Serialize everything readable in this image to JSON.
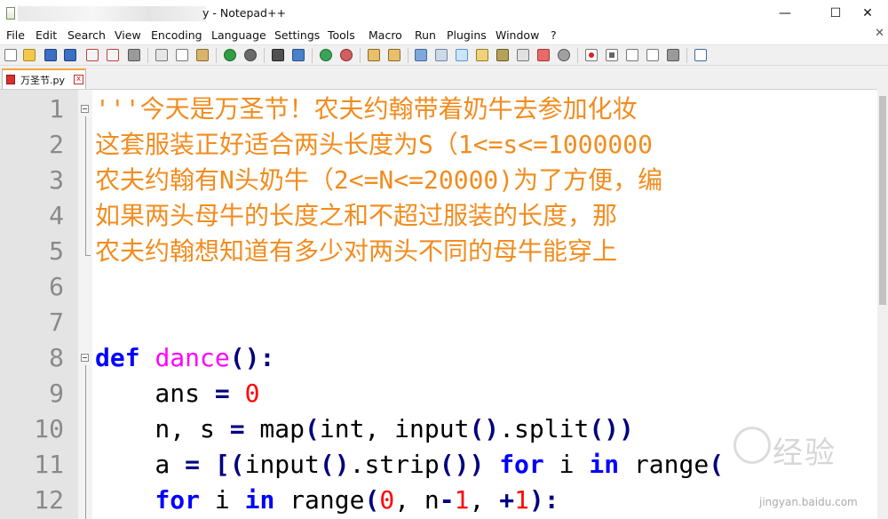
{
  "window": {
    "title": "y - Notepad++",
    "minimize_glyph": "—",
    "maximize_glyph": "☐",
    "close_glyph": "✕"
  },
  "menu": {
    "items": [
      "File",
      "Edit",
      "Search",
      "View",
      "Encoding",
      "Language",
      "Settings",
      "Tools",
      "Macro",
      "Run",
      "Plugins",
      "Window",
      "?"
    ],
    "close_glyph": "✕"
  },
  "toolbar": {
    "icons": [
      "new-file-icon",
      "open-file-icon",
      "save-icon",
      "save-all-icon",
      "close-icon",
      "close-all-icon",
      "print-icon",
      "cut-icon",
      "copy-icon",
      "paste-icon",
      "undo-icon",
      "redo-icon",
      "find-icon",
      "replace-icon",
      "zoom-in-icon",
      "zoom-out-icon",
      "sync-vertical-icon",
      "sync-horizontal-icon",
      "word-wrap-icon",
      "show-all-chars-icon",
      "indent-guide-icon",
      "user-language-icon",
      "doc-map-icon",
      "function-list-icon",
      "folder-workspace-icon",
      "monitor-icon",
      "record-macro-icon",
      "stop-macro-icon",
      "play-macro-icon",
      "run-macro-multiple-icon",
      "save-macro-icon",
      "launch-icon"
    ]
  },
  "tab": {
    "label": "万圣节.py",
    "close_glyph": "x"
  },
  "editor": {
    "lines": [
      {
        "num": "1",
        "segments": [
          {
            "t": "'''今天是万圣节！农夫约翰带着奶牛去参加化妆",
            "c": "doc"
          }
        ]
      },
      {
        "num": "2",
        "segments": [
          {
            "t": "这套服装正好适合两头长度为S（1<=s<=1000000",
            "c": "doc"
          }
        ]
      },
      {
        "num": "3",
        "segments": [
          {
            "t": "农夫约翰有N头奶牛（2<=N<=20000)为了方便，编",
            "c": "doc"
          }
        ]
      },
      {
        "num": "4",
        "segments": [
          {
            "t": "如果两头母牛的长度之和不超过服装的长度，那",
            "c": "doc"
          }
        ]
      },
      {
        "num": "5",
        "segments": [
          {
            "t": "农夫约翰想知道有多少对两头不同的母牛能穿上",
            "c": "doc"
          }
        ]
      },
      {
        "num": "6",
        "segments": []
      },
      {
        "num": "7",
        "segments": []
      },
      {
        "num": "8",
        "segments": [
          {
            "t": "def",
            "c": "kw"
          },
          {
            "t": " ",
            "c": ""
          },
          {
            "t": "dance",
            "c": "fn"
          },
          {
            "t": "():",
            "c": "op"
          }
        ]
      },
      {
        "num": "9",
        "segments": [
          {
            "t": "    ans ",
            "c": ""
          },
          {
            "t": "=",
            "c": "op"
          },
          {
            "t": " ",
            "c": ""
          },
          {
            "t": "0",
            "c": "num"
          }
        ]
      },
      {
        "num": "10",
        "segments": [
          {
            "t": "    n, s ",
            "c": ""
          },
          {
            "t": "=",
            "c": "op"
          },
          {
            "t": " map",
            "c": ""
          },
          {
            "t": "(",
            "c": "op"
          },
          {
            "t": "int, input",
            "c": ""
          },
          {
            "t": "()",
            "c": "op"
          },
          {
            "t": ".split",
            "c": ""
          },
          {
            "t": "())",
            "c": "op"
          }
        ]
      },
      {
        "num": "11",
        "segments": [
          {
            "t": "    a ",
            "c": ""
          },
          {
            "t": "=",
            "c": "op"
          },
          {
            "t": " ",
            "c": ""
          },
          {
            "t": "[(",
            "c": "op"
          },
          {
            "t": "input",
            "c": ""
          },
          {
            "t": "()",
            "c": "op"
          },
          {
            "t": ".strip",
            "c": ""
          },
          {
            "t": "())",
            "c": "op"
          },
          {
            "t": " ",
            "c": ""
          },
          {
            "t": "for",
            "c": "kw"
          },
          {
            "t": " i ",
            "c": ""
          },
          {
            "t": "in",
            "c": "kw"
          },
          {
            "t": " range",
            "c": ""
          },
          {
            "t": "(",
            "c": "op"
          }
        ]
      },
      {
        "num": "12",
        "segments": [
          {
            "t": "    ",
            "c": ""
          },
          {
            "t": "for",
            "c": "kw"
          },
          {
            "t": " i ",
            "c": ""
          },
          {
            "t": "in",
            "c": "kw"
          },
          {
            "t": " range",
            "c": ""
          },
          {
            "t": "(",
            "c": "op"
          },
          {
            "t": "0",
            "c": "num"
          },
          {
            "t": ", n",
            "c": ""
          },
          {
            "t": "-",
            "c": "op"
          },
          {
            "t": "1",
            "c": "num"
          },
          {
            "t": ", ",
            "c": ""
          },
          {
            "t": "+",
            "c": "op"
          },
          {
            "t": "1",
            "c": "num"
          },
          {
            "t": "):",
            "c": "op"
          }
        ]
      }
    ]
  },
  "watermark": {
    "text": "经验",
    "url": "jingyan.baidu.com"
  },
  "colors": {
    "docstring": "#f28c1e",
    "keyword": "#0000ff",
    "function_name": "#ff00ff",
    "number": "#ff0000",
    "tab_accent": "#f7a53b"
  }
}
